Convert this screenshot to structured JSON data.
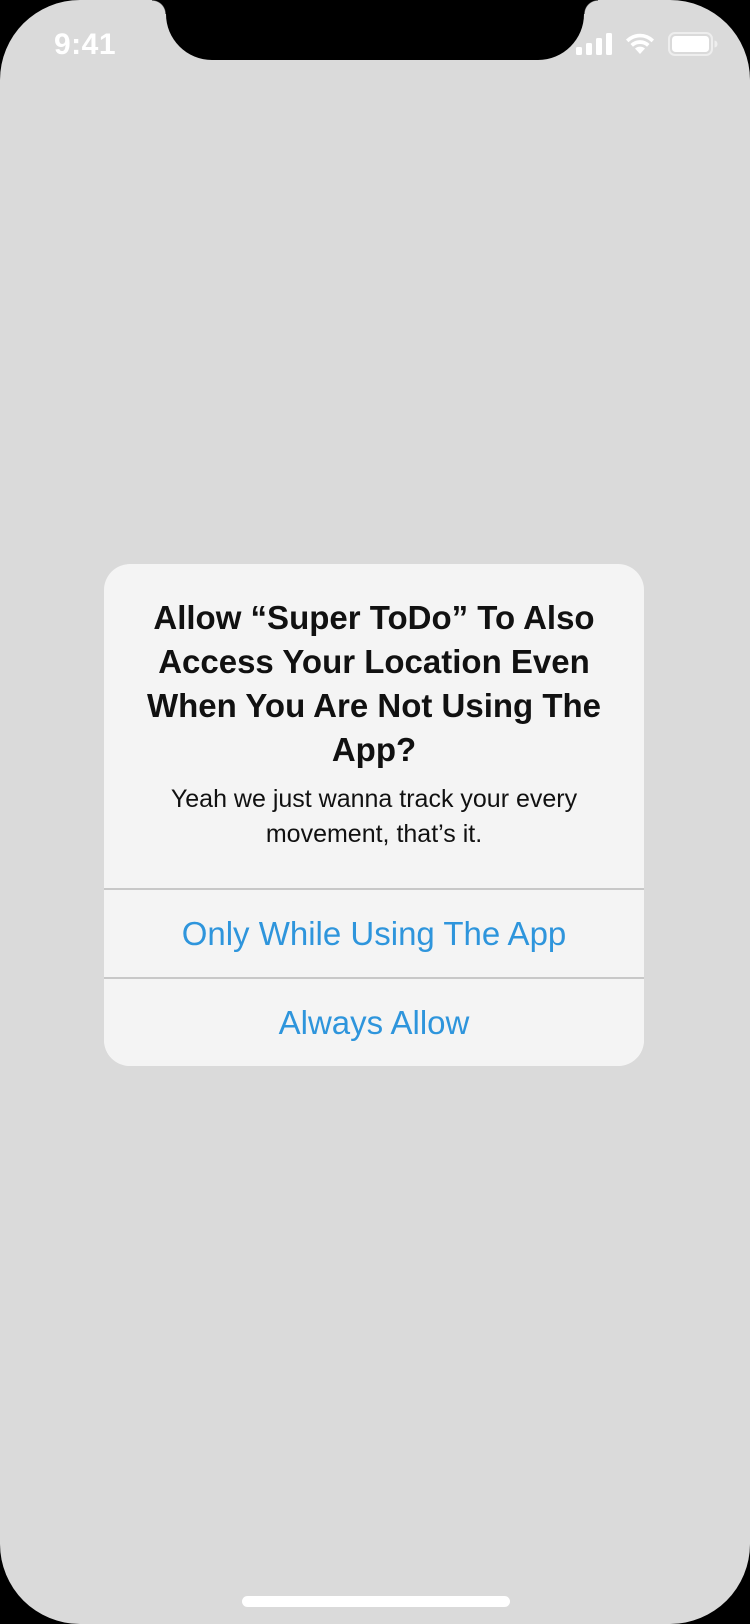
{
  "status_bar": {
    "time": "9:41",
    "icons": [
      "cellular-signal-icon",
      "wifi-icon",
      "battery-icon"
    ]
  },
  "alert": {
    "title": "Allow “Super ToDo” To Also Access Your Location Even When You Are Not Using The App?",
    "message": "Yeah we just wanna track your every movement, that’s it.",
    "buttons": [
      {
        "label": "Only While Using The App"
      },
      {
        "label": "Always Allow"
      }
    ]
  },
  "colors": {
    "background": "#dadada",
    "dialog": "#f4f4f4",
    "accent": "#2e95dc",
    "divider": "#c8c8c8"
  }
}
